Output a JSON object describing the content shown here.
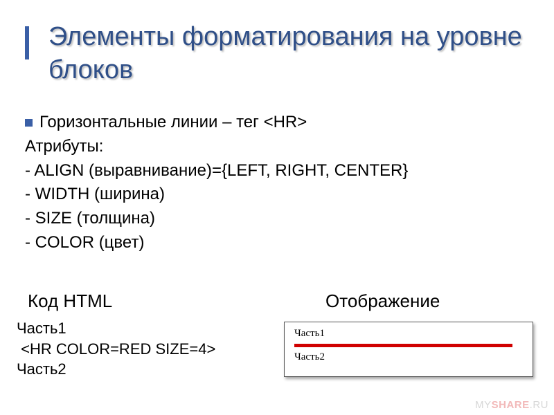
{
  "title": "Элементы форматирования на уровне блоков",
  "bullet1": "Горизонтальные линии – тег <HR>",
  "attrib_label": "Атрибуты:",
  "attrs": {
    "align": "ALIGN (выравнивание)={LEFT, RIGHT, CENTER}",
    "width": "WIDTH (ширина)",
    "size": "SIZE (толщина)",
    "color": "COLOR (цвет)"
  },
  "columns": {
    "code_label": "Код HTML",
    "display_label": "Отображение"
  },
  "code": {
    "line1": "Часть1",
    "line2": " <HR COLOR=RED SIZE=4>",
    "line3": "Часть2"
  },
  "render": {
    "part1": "Часть1",
    "part2": "Часть2",
    "hr_color": "#d00000",
    "hr_size_px": 5
  },
  "watermark": {
    "left": "MY",
    "right": "SHARE",
    "suffix": ".RU"
  }
}
